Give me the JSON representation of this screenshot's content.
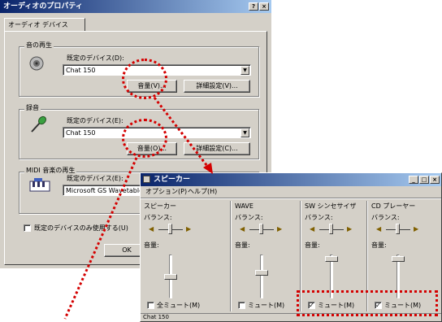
{
  "audio_props": {
    "title": "オーディオのプロパティ",
    "title_buttons": [
      "?",
      "×"
    ],
    "tab": "オーディオ デバイス",
    "playback": {
      "group": "音の再生",
      "device_label": "既定のデバイス(D):",
      "device_value": "Chat 150",
      "volume_btn": "音量(V)...",
      "advanced_btn": "詳細設定(V)..."
    },
    "recording": {
      "group": "録音",
      "device_label": "既定のデバイス(E):",
      "device_value": "Chat 150",
      "volume_btn": "音量(O)...",
      "advanced_btn": "詳細設定(C)..."
    },
    "midi": {
      "group": "MIDI 音楽の再生",
      "device_label": "既定のデバイス(E):",
      "device_value": "Microsoft GS Wavetable"
    },
    "use_default_only": "既定のデバイスのみ使用する(U)",
    "ok": "OK"
  },
  "speaker_mixer": {
    "title": "スピーカー",
    "title_buttons": [
      "_",
      "□",
      "×"
    ],
    "menu": [
      "オプション(P)",
      "ヘルプ(H)"
    ],
    "channels": [
      {
        "name": "スピーカー",
        "balance": "バランス:",
        "volume": "音量:",
        "mute": "全ミュート(M)",
        "muted": false,
        "level": 0.5
      },
      {
        "name": "WAVE",
        "balance": "バランス:",
        "volume": "音量:",
        "mute": "ミュート(M)",
        "muted": false,
        "level": 0.6
      },
      {
        "name": "SW シンセサイザ",
        "balance": "バランス:",
        "volume": "音量:",
        "mute": "ミュート(M)",
        "muted": true,
        "level": 0.95
      },
      {
        "name": "CD プレーヤー",
        "balance": "バランス:",
        "volume": "音量:",
        "mute": "ミュート(M)",
        "muted": true,
        "level": 0.95
      }
    ],
    "status": "Chat 150"
  }
}
